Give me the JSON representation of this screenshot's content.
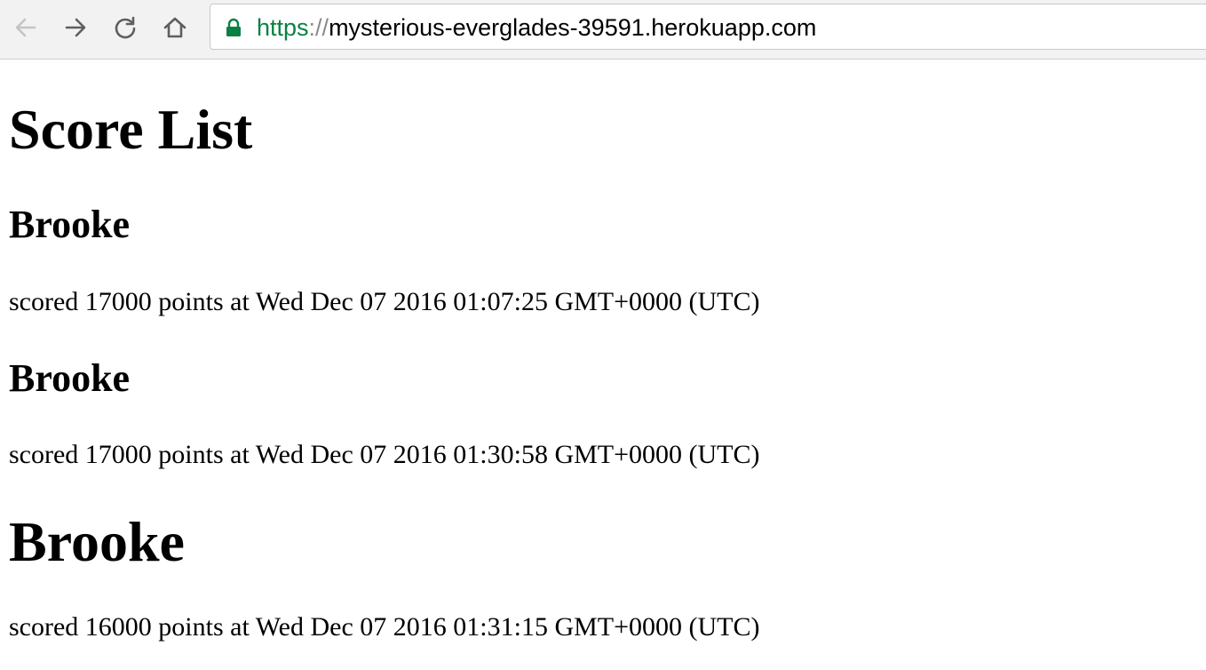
{
  "browser": {
    "url_scheme": "https",
    "url_separator": "://",
    "url_host": "mysterious-everglades-39591.herokuapp.com",
    "secure_color": "#0b8043",
    "icons": {
      "back": "back-arrow-icon",
      "forward": "forward-arrow-icon",
      "reload": "reload-icon",
      "home": "home-icon",
      "lock": "lock-icon"
    }
  },
  "page": {
    "title": "Score List",
    "entries": [
      {
        "name": "Brooke",
        "text": "scored 17000 points at Wed Dec 07 2016 01:07:25 GMT+0000 (UTC)"
      },
      {
        "name": "Brooke",
        "text": "scored 17000 points at Wed Dec 07 2016 01:30:58 GMT+0000 (UTC)"
      },
      {
        "name": "Brooke",
        "text": "scored 16000 points at Wed Dec 07 2016 01:31:15 GMT+0000 (UTC)"
      }
    ]
  }
}
